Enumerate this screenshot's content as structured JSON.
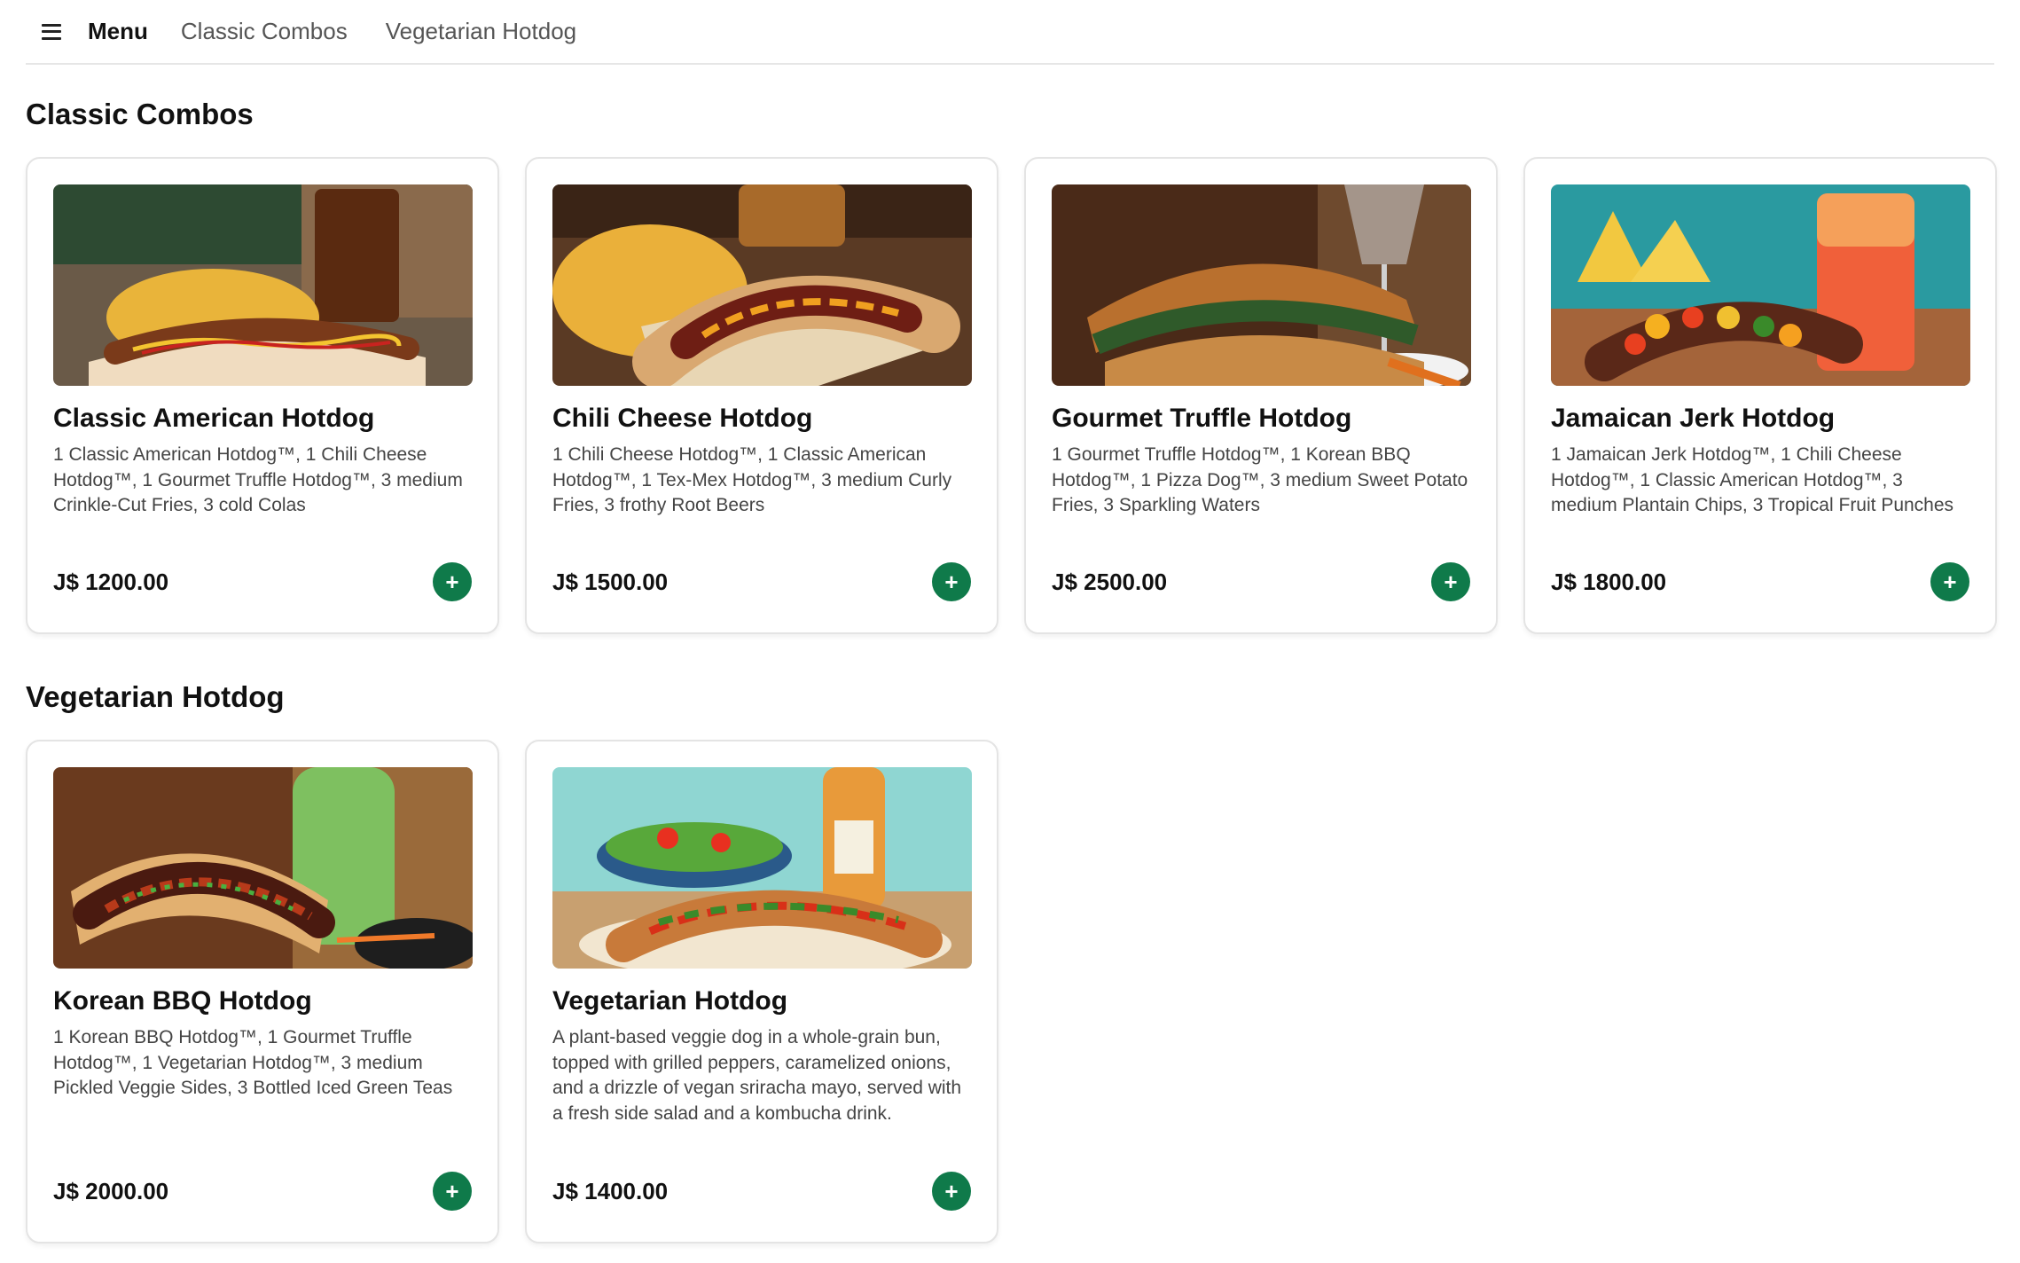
{
  "nav": {
    "title": "Menu",
    "links": [
      "Classic Combos",
      "Vegetarian Hotdog"
    ]
  },
  "sections": [
    {
      "title": "Classic Combos",
      "items": [
        {
          "name": "Classic American Hotdog",
          "description": "1 Classic American Hotdog™, 1 Chili Cheese Hotdog™, 1 Gourmet Truffle Hotdog™, 3 medium Crinkle-Cut Fries, 3 cold Colas",
          "price": "J$ 1200.00",
          "add_label": "+"
        },
        {
          "name": "Chili Cheese Hotdog",
          "description": "1 Chili Cheese Hotdog™, 1 Classic American Hotdog™, 1 Tex-Mex Hotdog™, 3 medium Curly Fries, 3 frothy Root Beers",
          "price": "J$ 1500.00",
          "add_label": "+"
        },
        {
          "name": "Gourmet Truffle Hotdog",
          "description": "1 Gourmet Truffle Hotdog™, 1 Korean BBQ Hotdog™, 1 Pizza Dog™, 3 medium Sweet Potato Fries, 3 Sparkling Waters",
          "price": "J$ 2500.00",
          "add_label": "+"
        },
        {
          "name": "Jamaican Jerk Hotdog",
          "description": "1 Jamaican Jerk Hotdog™, 1 Chili Cheese Hotdog™, 1 Classic American Hotdog™, 3 medium Plantain Chips, 3 Tropical Fruit Punches",
          "price": "J$ 1800.00",
          "add_label": "+"
        }
      ]
    },
    {
      "title": "Vegetarian Hotdog",
      "items": [
        {
          "name": "Korean BBQ Hotdog",
          "description": "1 Korean BBQ Hotdog™, 1 Gourmet Truffle Hotdog™, 1 Vegetarian Hotdog™, 3 medium Pickled Veggie Sides, 3 Bottled Iced Green Teas",
          "price": "J$ 2000.00",
          "add_label": "+"
        },
        {
          "name": "Vegetarian Hotdog",
          "description": "A plant-based veggie dog in a whole-grain bun, topped with grilled peppers, caramelized onions, and a drizzle of vegan sriracha mayo, served with a fresh side salad and a kombucha drink.",
          "price": "J$ 1400.00",
          "add_label": "+"
        }
      ]
    }
  ],
  "colors": {
    "accent": "#0f7a4a",
    "border": "#e4e4e4",
    "text_muted": "#444444"
  },
  "icons": {
    "menu": "hamburger-icon",
    "add": "plus-icon"
  }
}
